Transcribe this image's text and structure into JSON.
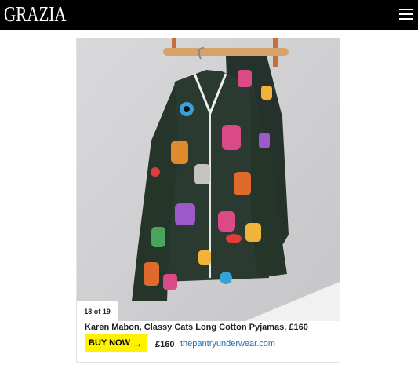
{
  "header": {
    "logo_text": "GRAZIA",
    "menu_icon": "hamburger-menu-icon",
    "background": "#000000"
  },
  "gallery": {
    "counter": "18 of 19",
    "caption": "Karen Mabon, Classy Cats Long Cotton Pyjamas, £160",
    "buy_label": "BUY NOW",
    "buy_icon": "arrow-right-icon",
    "buy_color": "#fff200",
    "price": "£160",
    "retailer_link": "thepantryunderwear.com",
    "link_color": "#1e6fb0"
  }
}
